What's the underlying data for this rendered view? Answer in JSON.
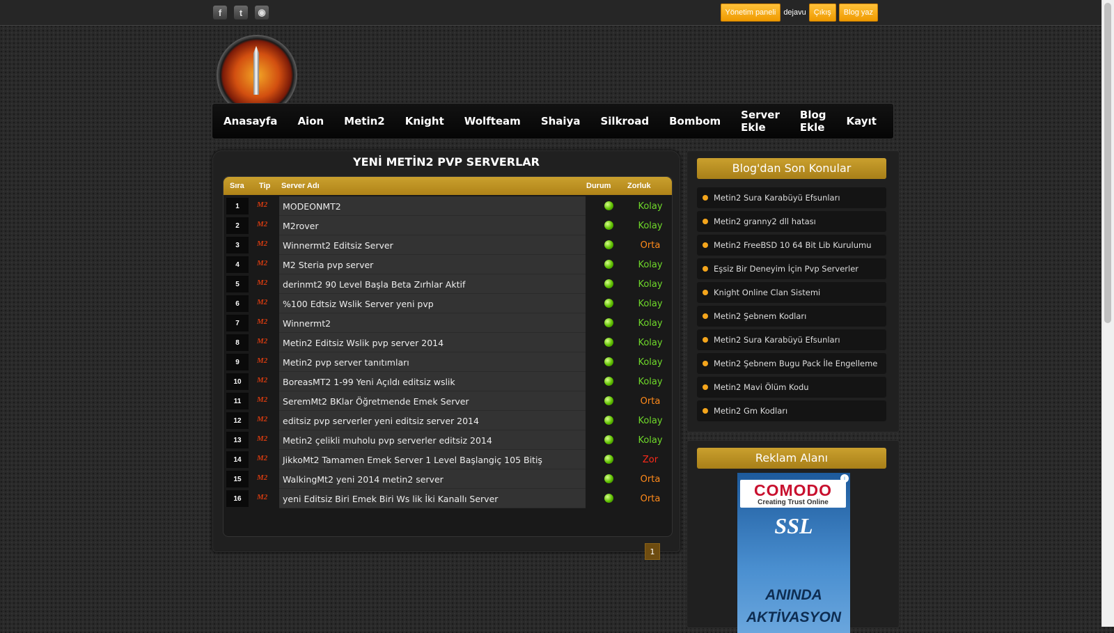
{
  "topbar": {
    "social_icons": [
      "facebook-icon",
      "twitter-icon",
      "rss-icon"
    ],
    "panel_button": "Yönetim paneli",
    "username": "dejavu",
    "logout_button": "Çıkış",
    "blog_button": "Blog yaz"
  },
  "nav": {
    "items": [
      "Anasayfa",
      "Aion",
      "Metin2",
      "Knight",
      "Wolfteam",
      "Shaiya",
      "Silkroad",
      "Bombom",
      "Server Ekle",
      "Blog Ekle",
      "Kayıt"
    ]
  },
  "servers": {
    "title": "YENİ METİN2 PVP SERVERLAR",
    "headers": {
      "no": "Sıra",
      "type": "Tip",
      "name": "Server Adı",
      "status": "Durum",
      "difficulty": "Zorluk"
    },
    "rows": [
      {
        "no": "1",
        "type": "M2",
        "name": "MODEONMT2",
        "difficulty": "Kolay"
      },
      {
        "no": "2",
        "type": "M2",
        "name": "M2rover",
        "difficulty": "Kolay"
      },
      {
        "no": "3",
        "type": "M2",
        "name": "Winnermt2 Editsiz Server",
        "difficulty": "Orta"
      },
      {
        "no": "4",
        "type": "M2",
        "name": "M2 Steria pvp server",
        "difficulty": "Kolay"
      },
      {
        "no": "5",
        "type": "M2",
        "name": "derinmt2 90 Level Başla Beta Zırhlar Aktif",
        "difficulty": "Kolay"
      },
      {
        "no": "6",
        "type": "M2",
        "name": "%100 Edtsiz Wslik Server yeni pvp",
        "difficulty": "Kolay"
      },
      {
        "no": "7",
        "type": "M2",
        "name": "Winnermt2",
        "difficulty": "Kolay"
      },
      {
        "no": "8",
        "type": "M2",
        "name": "Metin2 Editsiz Wslik pvp server 2014",
        "difficulty": "Kolay"
      },
      {
        "no": "9",
        "type": "M2",
        "name": "Metin2 pvp server tanıtımları",
        "difficulty": "Kolay"
      },
      {
        "no": "10",
        "type": "M2",
        "name": "BoreasMT2 1-99 Yeni Açıldı editsiz wslik",
        "difficulty": "Kolay"
      },
      {
        "no": "11",
        "type": "M2",
        "name": "SeremMt2 BKlar Öğretmende Emek Server",
        "difficulty": "Orta"
      },
      {
        "no": "12",
        "type": "M2",
        "name": "editsiz pvp serverler yeni editsiz server 2014",
        "difficulty": "Kolay"
      },
      {
        "no": "13",
        "type": "M2",
        "name": "Metin2 çelikli muholu pvp serverler editsiz 2014",
        "difficulty": "Kolay"
      },
      {
        "no": "14",
        "type": "M2",
        "name": "JikkoMt2 Tamamen Emek Server 1 Level Başlangiç 105 Bitiş",
        "difficulty": "Zor"
      },
      {
        "no": "15",
        "type": "M2",
        "name": "WalkingMt2 yeni 2014 metin2 server",
        "difficulty": "Orta"
      },
      {
        "no": "16",
        "type": "M2",
        "name": "yeni Editsiz Biri Emek Biri Ws lik İki Kanallı Server",
        "difficulty": "Orta"
      }
    ],
    "page": "1"
  },
  "colors": {
    "Kolay": "#6fd82a",
    "Orta": "#ff8a1a",
    "Zor": "#ff2a1a",
    "accent": "#c49a26"
  },
  "blog": {
    "title": "Blog'dan Son Konular",
    "items": [
      "Metin2 Sura Karabüyü Efsunları",
      "Metin2 granny2 dll hatası",
      "Metin2 FreeBSD 10 64 Bit Lib Kurulumu",
      "Eşsiz Bir Deneyim İçin Pvp Serverler",
      "Knight Online Clan Sistemi",
      "Metin2 Şebnem Kodları",
      "Metin2 Sura Karabüyü Efsunları",
      "Metin2 Şebnem Bugu Pack İle Engelleme",
      "Metin2 Mavi Ölüm Kodu",
      "Metin2 Gm Kodları"
    ]
  },
  "ad": {
    "title": "Reklam Alanı",
    "brand": "COMODO",
    "tagline": "Creating Trust Online",
    "product": "SSL",
    "line1": "ANINDA",
    "line2": "AKTİVASYON"
  }
}
